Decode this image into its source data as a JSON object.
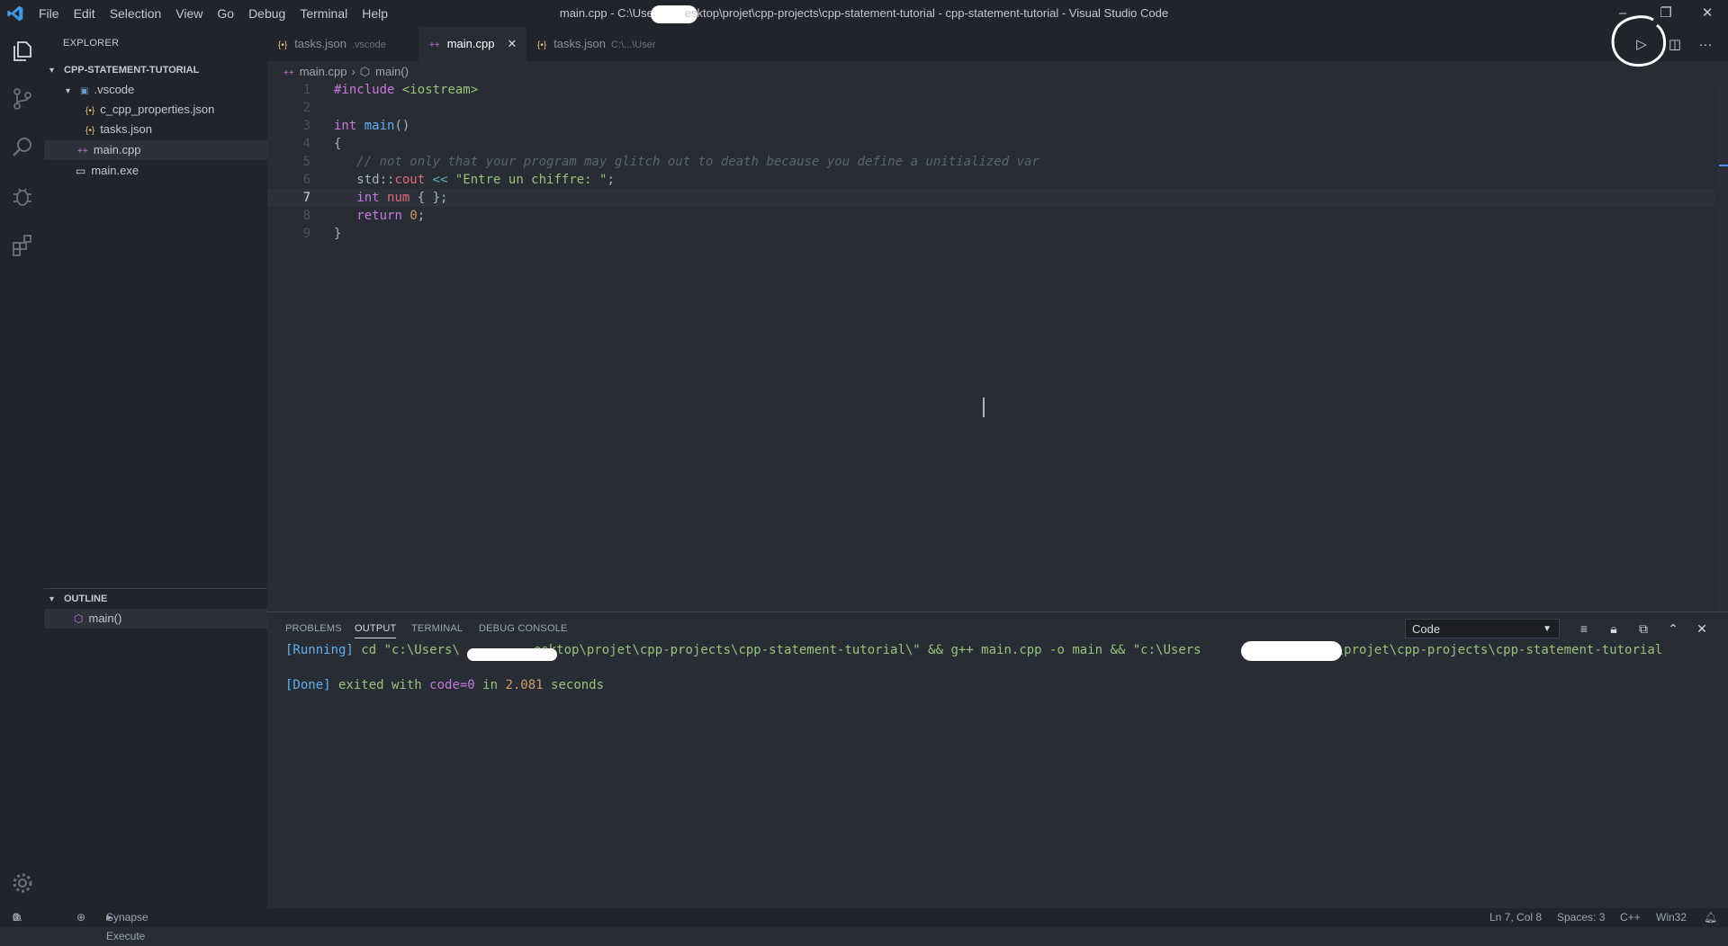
{
  "titlebar": {
    "menu": [
      "File",
      "Edit",
      "Selection",
      "View",
      "Go",
      "Debug",
      "Terminal",
      "Help"
    ],
    "title_pre": "main.cpp - C:\\Users",
    "title_post": "esktop\\projet\\cpp-projects\\cpp-statement-tutorial - cpp-statement-tutorial - Visual Studio Code"
  },
  "sidebar": {
    "header": "EXPLORER",
    "folder": "CPP-STATEMENT-TUTORIAL",
    "items": [
      {
        "label": ".vscode",
        "icon": "folder-icon"
      },
      {
        "label": "c_cpp_properties.json",
        "icon": "json-file-icon"
      },
      {
        "label": "tasks.json",
        "icon": "json-file-icon"
      },
      {
        "label": "main.cpp",
        "icon": "cpp-file-icon"
      },
      {
        "label": "main.exe",
        "icon": "binary-file-icon"
      }
    ],
    "outline_header": "OUTLINE",
    "outline_item": "main()"
  },
  "tabs": [
    {
      "label": "tasks.json",
      "desc": ".vscode"
    },
    {
      "label": "main.cpp",
      "desc": ""
    },
    {
      "label": "tasks.json",
      "desc": "C:\\...\\User"
    }
  ],
  "breadcrumb": {
    "file": "main.cpp",
    "symbol": "main()"
  },
  "editor": {
    "line_numbers": [
      "1",
      "2",
      "3",
      "4",
      "5",
      "6",
      "7",
      "8",
      "9"
    ],
    "current_line": 7
  },
  "panel": {
    "tabs": [
      "PROBLEMS",
      "OUTPUT",
      "TERMINAL",
      "DEBUG CONSOLE"
    ],
    "channel": "Code",
    "running_tag": "[Running]",
    "running_cmd_a": " cd \"c:\\Users\\",
    "running_cmd_b": "esktop\\projet\\cpp-projects\\cpp-statement-tutorial\\\" && g++ main.cpp -o main && \"c:\\Users",
    "running_cmd_c": "sktop\\projet\\cpp-projects\\cpp-statement-tutorial",
    "done_tag": "[Done]",
    "done_text": " exited with ",
    "done_code": "code=0",
    "done_in": " in ",
    "done_time": "2.081",
    "done_seconds": " seconds"
  },
  "status": {
    "errors": "0",
    "warnings": "0",
    "execute": "Synapse Execute",
    "position": "Ln 7, Col 8",
    "spaces": "Spaces: 3",
    "language": "C++",
    "platform": "Win32"
  },
  "colors": {
    "accent": "#528bff",
    "background": "#282c34",
    "chrome": "#21252b"
  }
}
